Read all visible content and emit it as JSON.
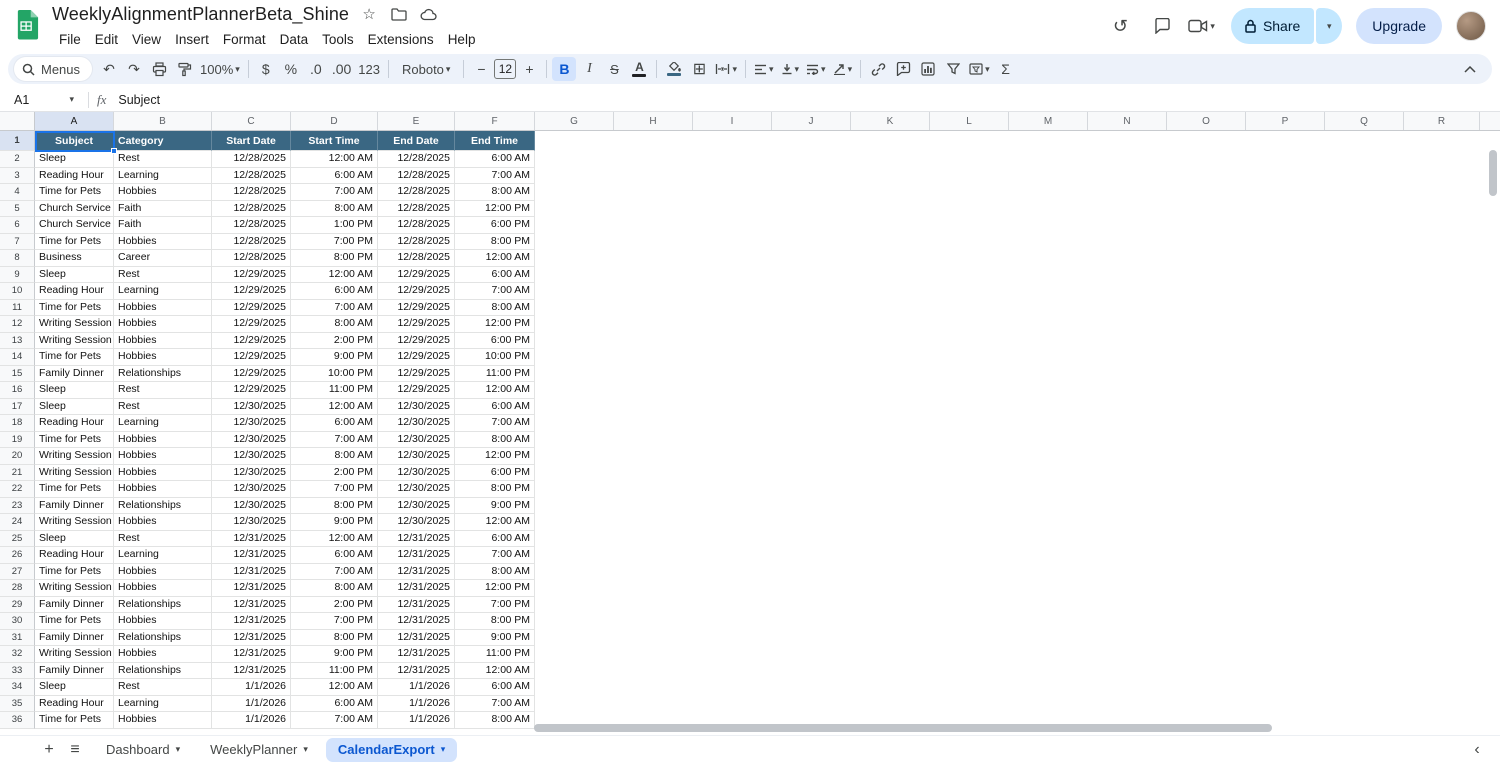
{
  "header": {
    "title": "WeeklyAlignmentPlannerBeta_Shine"
  },
  "menubar": {
    "items": [
      "File",
      "Edit",
      "View",
      "Insert",
      "Format",
      "Data",
      "Tools",
      "Extensions",
      "Help"
    ]
  },
  "actions": {
    "share": "Share",
    "upgrade": "Upgrade"
  },
  "icons": {
    "star": "☆",
    "undo": "↶",
    "redo": "↷",
    "history": "↺",
    "borders": "⊞",
    "caret": "▾",
    "minus": "−",
    "plus": "+",
    "all_sheets": "≡",
    "chevron_left": "‹"
  },
  "toolbar": {
    "menus_label": "Menus",
    "zoom": "100%",
    "currency": "$",
    "percent": "%",
    "dec_decrease": ".0",
    "dec_increase": ".00",
    "format_number": "123",
    "font_family": "Roboto",
    "font_size": "12",
    "bold": "B",
    "italic": "I",
    "strikethrough": "S",
    "text_color": "A",
    "functions": "Σ"
  },
  "formula_bar": {
    "cell_ref": "A1",
    "fx": "fx",
    "value": "Subject"
  },
  "grid": {
    "columns": [
      "A",
      "B",
      "C",
      "D",
      "E",
      "F",
      "G",
      "H",
      "I",
      "J",
      "K",
      "L",
      "M",
      "N",
      "O",
      "P",
      "Q",
      "R"
    ],
    "header_row": [
      "Subject",
      "Category",
      "Start Date",
      "Start Time",
      "End Date",
      "End Time"
    ],
    "first_data_row_number": 2,
    "rows": [
      [
        "Sleep",
        "Rest",
        "12/28/2025",
        "12:00 AM",
        "12/28/2025",
        "6:00 AM"
      ],
      [
        "Reading Hour",
        "Learning",
        "12/28/2025",
        "6:00 AM",
        "12/28/2025",
        "7:00 AM"
      ],
      [
        "Time for Pets",
        "Hobbies",
        "12/28/2025",
        "7:00 AM",
        "12/28/2025",
        "8:00 AM"
      ],
      [
        "Church Service",
        "Faith",
        "12/28/2025",
        "8:00 AM",
        "12/28/2025",
        "12:00 PM"
      ],
      [
        "Church Service",
        "Faith",
        "12/28/2025",
        "1:00 PM",
        "12/28/2025",
        "6:00 PM"
      ],
      [
        "Time for Pets",
        "Hobbies",
        "12/28/2025",
        "7:00 PM",
        "12/28/2025",
        "8:00 PM"
      ],
      [
        "Business",
        "Career",
        "12/28/2025",
        "8:00 PM",
        "12/28/2025",
        "12:00 AM"
      ],
      [
        "Sleep",
        "Rest",
        "12/29/2025",
        "12:00 AM",
        "12/29/2025",
        "6:00 AM"
      ],
      [
        "Reading Hour",
        "Learning",
        "12/29/2025",
        "6:00 AM",
        "12/29/2025",
        "7:00 AM"
      ],
      [
        "Time for Pets",
        "Hobbies",
        "12/29/2025",
        "7:00 AM",
        "12/29/2025",
        "8:00 AM"
      ],
      [
        "Writing Session",
        "Hobbies",
        "12/29/2025",
        "8:00 AM",
        "12/29/2025",
        "12:00 PM"
      ],
      [
        "Writing Session",
        "Hobbies",
        "12/29/2025",
        "2:00 PM",
        "12/29/2025",
        "6:00 PM"
      ],
      [
        "Time for Pets",
        "Hobbies",
        "12/29/2025",
        "9:00 PM",
        "12/29/2025",
        "10:00 PM"
      ],
      [
        "Family Dinner",
        "Relationships",
        "12/29/2025",
        "10:00 PM",
        "12/29/2025",
        "11:00 PM"
      ],
      [
        "Sleep",
        "Rest",
        "12/29/2025",
        "11:00 PM",
        "12/29/2025",
        "12:00 AM"
      ],
      [
        "Sleep",
        "Rest",
        "12/30/2025",
        "12:00 AM",
        "12/30/2025",
        "6:00 AM"
      ],
      [
        "Reading Hour",
        "Learning",
        "12/30/2025",
        "6:00 AM",
        "12/30/2025",
        "7:00 AM"
      ],
      [
        "Time for Pets",
        "Hobbies",
        "12/30/2025",
        "7:00 AM",
        "12/30/2025",
        "8:00 AM"
      ],
      [
        "Writing Session",
        "Hobbies",
        "12/30/2025",
        "8:00 AM",
        "12/30/2025",
        "12:00 PM"
      ],
      [
        "Writing Session",
        "Hobbies",
        "12/30/2025",
        "2:00 PM",
        "12/30/2025",
        "6:00 PM"
      ],
      [
        "Time for Pets",
        "Hobbies",
        "12/30/2025",
        "7:00 PM",
        "12/30/2025",
        "8:00 PM"
      ],
      [
        "Family Dinner",
        "Relationships",
        "12/30/2025",
        "8:00 PM",
        "12/30/2025",
        "9:00 PM"
      ],
      [
        "Writing Session",
        "Hobbies",
        "12/30/2025",
        "9:00 PM",
        "12/30/2025",
        "12:00 AM"
      ],
      [
        "Sleep",
        "Rest",
        "12/31/2025",
        "12:00 AM",
        "12/31/2025",
        "6:00 AM"
      ],
      [
        "Reading Hour",
        "Learning",
        "12/31/2025",
        "6:00 AM",
        "12/31/2025",
        "7:00 AM"
      ],
      [
        "Time for Pets",
        "Hobbies",
        "12/31/2025",
        "7:00 AM",
        "12/31/2025",
        "8:00 AM"
      ],
      [
        "Writing Session",
        "Hobbies",
        "12/31/2025",
        "8:00 AM",
        "12/31/2025",
        "12:00 PM"
      ],
      [
        "Family Dinner",
        "Relationships",
        "12/31/2025",
        "2:00 PM",
        "12/31/2025",
        "7:00 PM"
      ],
      [
        "Time for Pets",
        "Hobbies",
        "12/31/2025",
        "7:00 PM",
        "12/31/2025",
        "8:00 PM"
      ],
      [
        "Family Dinner",
        "Relationships",
        "12/31/2025",
        "8:00 PM",
        "12/31/2025",
        "9:00 PM"
      ],
      [
        "Writing Session",
        "Hobbies",
        "12/31/2025",
        "9:00 PM",
        "12/31/2025",
        "11:00 PM"
      ],
      [
        "Family Dinner",
        "Relationships",
        "12/31/2025",
        "11:00 PM",
        "12/31/2025",
        "12:00 AM"
      ],
      [
        "Sleep",
        "Rest",
        "1/1/2026",
        "12:00 AM",
        "1/1/2026",
        "6:00 AM"
      ],
      [
        "Reading Hour",
        "Learning",
        "1/1/2026",
        "6:00 AM",
        "1/1/2026",
        "7:00 AM"
      ],
      [
        "Time for Pets",
        "Hobbies",
        "1/1/2026",
        "7:00 AM",
        "1/1/2026",
        "8:00 AM"
      ]
    ]
  },
  "sheet_tabs": [
    {
      "label": "Dashboard",
      "active": false
    },
    {
      "label": "WeeklyPlanner",
      "active": false
    },
    {
      "label": "CalendarExport",
      "active": true
    }
  ],
  "colors": {
    "header_fill": "#3a6783",
    "selection_blue": "#1a73e8",
    "share_bg": "#c2e7ff",
    "upgrade_bg": "#d3e3fd",
    "active_tab_bg": "#d3e3fd",
    "active_tab_text": "#0b57d0",
    "toolbar_bg": "#edf2fa"
  }
}
